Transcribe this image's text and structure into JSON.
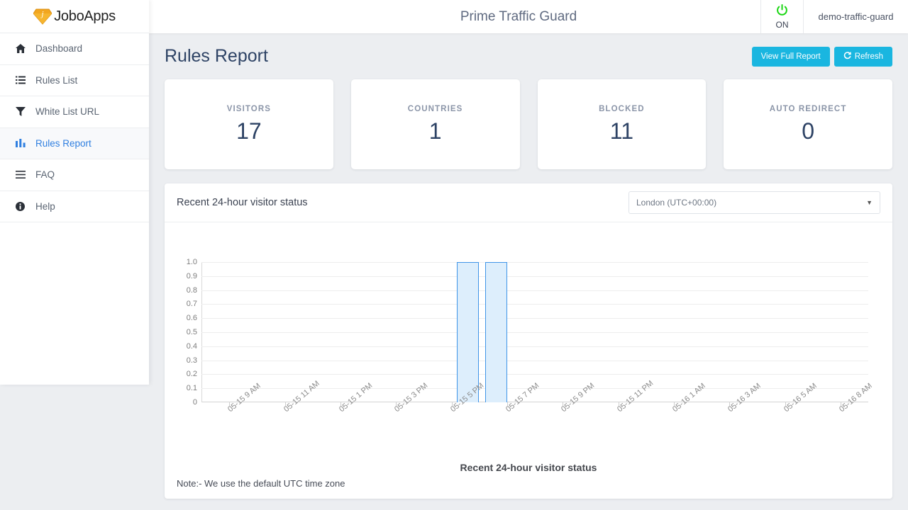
{
  "brand": {
    "name": "JoboApps",
    "gem_letter": "j",
    "icon": "gem-icon"
  },
  "sidebar": {
    "items": [
      {
        "label": "Dashboard",
        "icon": "home-icon",
        "glyph": "⌂",
        "active": false
      },
      {
        "label": "Rules List",
        "icon": "list-icon",
        "glyph": "☰",
        "active": false
      },
      {
        "label": "White List URL",
        "icon": "filter-icon",
        "glyph": "▼",
        "active": false
      },
      {
        "label": "Rules Report",
        "icon": "bar-chart-icon",
        "glyph": "█",
        "active": true
      },
      {
        "label": "FAQ",
        "icon": "hamburger-icon",
        "glyph": "≡",
        "active": false
      },
      {
        "label": "Help",
        "icon": "info-circle-icon",
        "glyph": "ℹ",
        "active": false
      }
    ]
  },
  "topbar": {
    "title": "Prime Traffic Guard",
    "power_state": "ON",
    "power_icon": "power-icon",
    "power_color": "#18d611",
    "username": "demo-traffic-guard"
  },
  "page": {
    "title": "Rules Report",
    "buttons": {
      "view_full_report": "View Full Report",
      "refresh": "Refresh",
      "refresh_icon": "refresh-icon"
    },
    "accent_color": "#1ab6e0"
  },
  "stats": [
    {
      "label": "VISITORS",
      "value": "17"
    },
    {
      "label": "COUNTRIES",
      "value": "1"
    },
    {
      "label": "BLOCKED",
      "value": "11"
    },
    {
      "label": "AUTO REDIRECT",
      "value": "0"
    }
  ],
  "panel": {
    "title": "Recent 24-hour visitor status",
    "timezone_selected": "London (UTC+00:00)",
    "caret_icon": "chevron-down-icon",
    "note": "Note:- We use the default UTC time zone"
  },
  "chart_data": {
    "type": "bar",
    "title": "Recent 24-hour visitor status",
    "xlabel": "",
    "ylabel": "",
    "ylim": [
      0,
      1.0
    ],
    "ytick_labels": [
      "1.0",
      "0.9",
      "0.8",
      "0.7",
      "0.6",
      "0.5",
      "0.4",
      "0.3",
      "0.2",
      "0.1",
      "0"
    ],
    "ytick_values": [
      1.0,
      0.9,
      0.8,
      0.7,
      0.6,
      0.5,
      0.4,
      0.3,
      0.2,
      0.1,
      0
    ],
    "grid": true,
    "legend": false,
    "xtick_labels": [
      "05-15 9 AM",
      "05-15 11 AM",
      "05-15 1 PM",
      "05-15 3 PM",
      "05-15 5 PM",
      "05-15 7 PM",
      "05-15 9 PM",
      "05-15 11 PM",
      "05-16 1 AM",
      "05-16 3 AM",
      "05-16 5 AM",
      "05-16 8 AM"
    ],
    "bar_color": "#ddeefc",
    "bar_border_color": "#3f94e8",
    "bars": [
      {
        "x_frac": 0.383,
        "width_frac": 0.033,
        "value": 1.0
      },
      {
        "x_frac": 0.425,
        "width_frac": 0.033,
        "value": 1.0
      }
    ]
  }
}
